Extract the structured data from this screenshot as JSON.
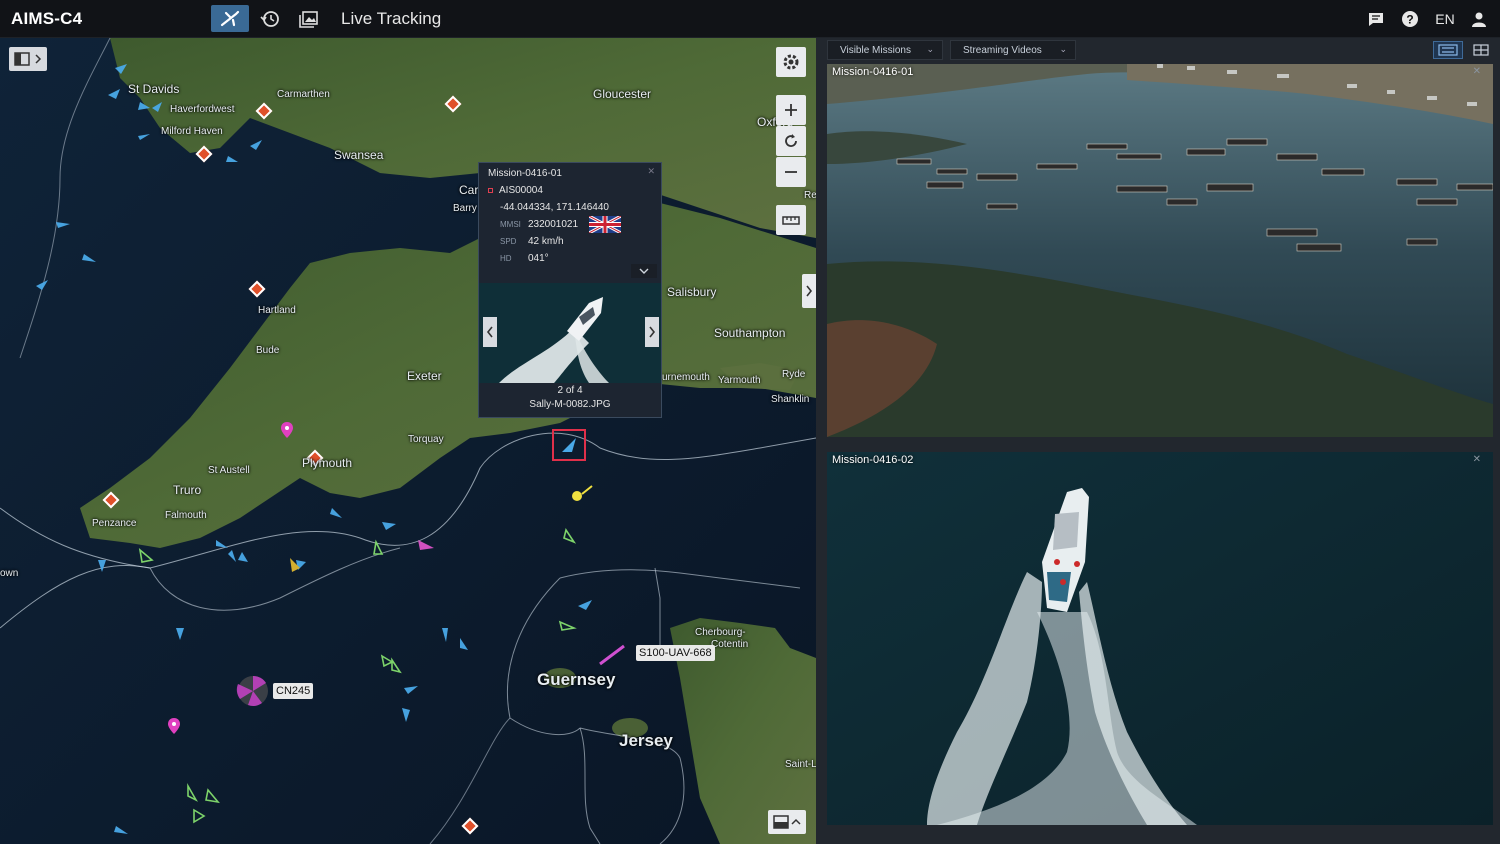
{
  "app": {
    "brand": "AIMS-C4",
    "page_title": "Live Tracking"
  },
  "topbar": {
    "nav": [
      {
        "name": "live-tracking",
        "icon": "airplane-icon",
        "active": true
      },
      {
        "name": "history",
        "icon": "history-icon",
        "active": false
      },
      {
        "name": "gallery",
        "icon": "gallery-icon",
        "active": false
      }
    ],
    "language": "EN",
    "right_icons": [
      "chat-icon",
      "help-icon",
      "user-icon"
    ]
  },
  "map": {
    "labels": [
      {
        "text": "St Davids",
        "size": "normal"
      },
      {
        "text": "Haverfordwest",
        "size": "small"
      },
      {
        "text": "Milford Haven",
        "size": "small"
      },
      {
        "text": "Carmarthen",
        "size": "small"
      },
      {
        "text": "Swansea",
        "size": "normal"
      },
      {
        "text": "Gloucester",
        "size": "normal"
      },
      {
        "text": "Oxford",
        "size": "normal"
      },
      {
        "text": "Car",
        "size": "normal"
      },
      {
        "text": "Barry",
        "size": "small"
      },
      {
        "text": "Hartland",
        "size": "small"
      },
      {
        "text": "Bude",
        "size": "small"
      },
      {
        "text": "Exeter",
        "size": "normal"
      },
      {
        "text": "Salisbury",
        "size": "normal"
      },
      {
        "text": "Southampton",
        "size": "normal"
      },
      {
        "text": "Yarmouth",
        "size": "small"
      },
      {
        "text": "Ryde",
        "size": "small"
      },
      {
        "text": "Shanklin",
        "size": "small"
      },
      {
        "text": "urnemouth",
        "size": "small"
      },
      {
        "text": "Torquay",
        "size": "small"
      },
      {
        "text": "Plymouth",
        "size": "normal"
      },
      {
        "text": "St Austell",
        "size": "small"
      },
      {
        "text": "Truro",
        "size": "normal"
      },
      {
        "text": "Falmouth",
        "size": "small"
      },
      {
        "text": "Penzance",
        "size": "small"
      },
      {
        "text": "own",
        "size": "small"
      },
      {
        "text": "Cherbourg-",
        "size": "small"
      },
      {
        "text": "Cotentin",
        "size": "small"
      },
      {
        "text": "Guernsey",
        "size": "big"
      },
      {
        "text": "Jersey",
        "size": "big"
      },
      {
        "text": "Saint-L",
        "size": "small"
      },
      {
        "text": "Re",
        "size": "small"
      }
    ],
    "tags": {
      "uav": "S100-UAV-668",
      "cn": "CN245"
    },
    "controls": [
      "settings-icon",
      "zoom-in-icon",
      "reset-icon",
      "zoom-out-icon",
      "ruler-icon",
      "expand-panel-icon",
      "minimap-icon"
    ]
  },
  "popup": {
    "mission": "Mission-0416-01",
    "ais": "AIS00004",
    "coords": "-44.044334, 171.146440",
    "mmsi_label": "MMSI",
    "mmsi": "232001021",
    "spd_label": "SPD",
    "spd": "42 km/h",
    "hd_label": "HD",
    "hd": "041°",
    "counter": "2 of 4",
    "filename": "Sally-M-0082.JPG"
  },
  "panel": {
    "dropdowns": [
      "Visible Missions",
      "Streaming Videos"
    ],
    "videos": [
      {
        "title": "Mission-0416-01"
      },
      {
        "title": "Mission-0416-02"
      }
    ]
  }
}
